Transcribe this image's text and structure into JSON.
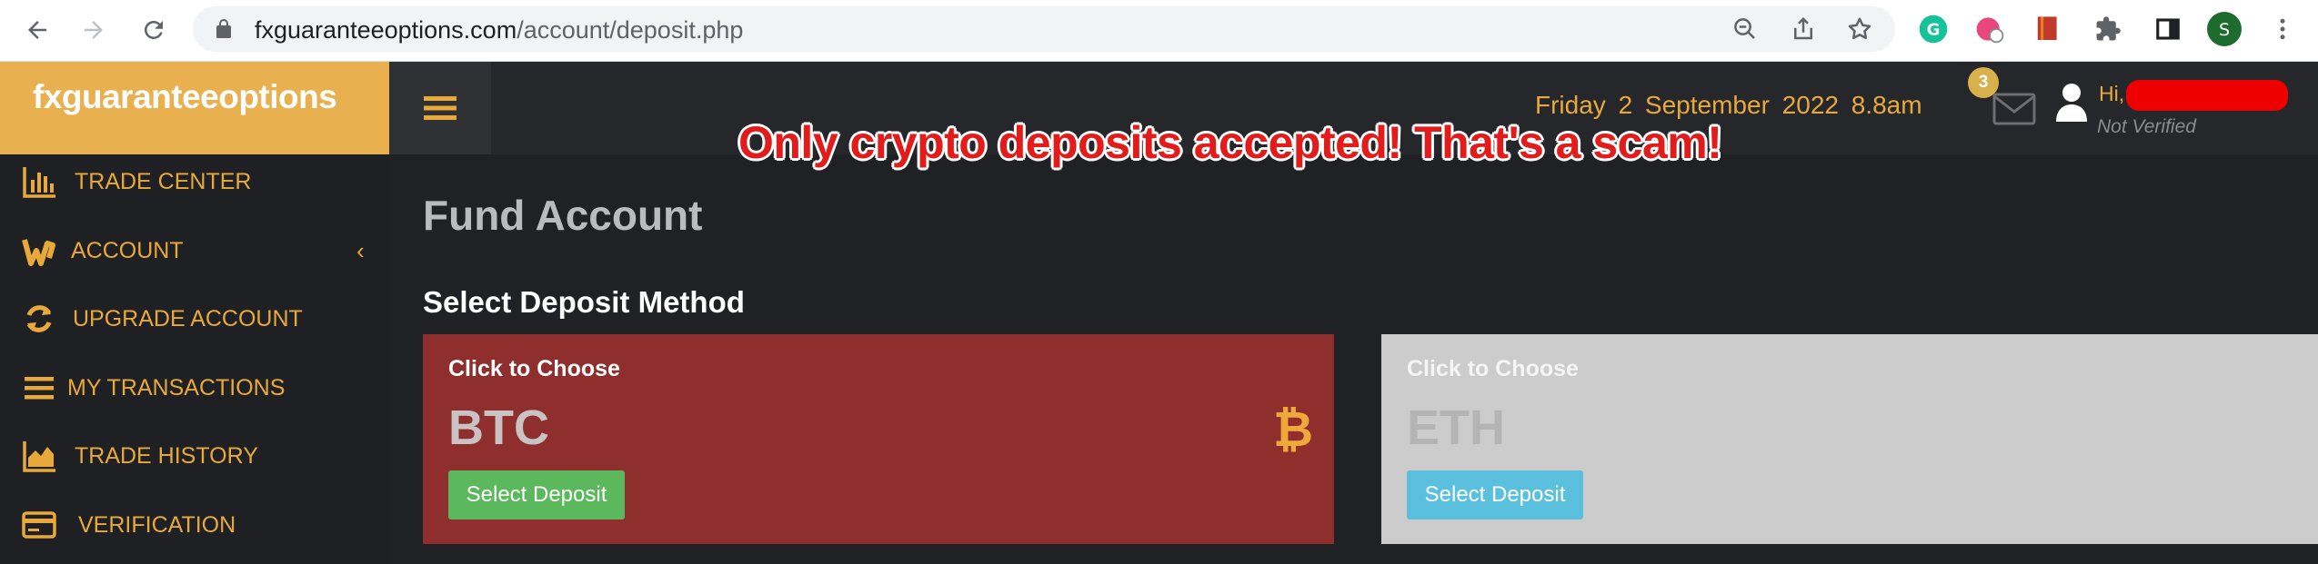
{
  "browser": {
    "url_host": "fxguaranteeoptions.com",
    "url_path": "/account/deposit.php",
    "profile_initial": "S"
  },
  "site": {
    "brand": "fxguaranteeoptions",
    "accent_color": "#e8b04f"
  },
  "sidebar": {
    "items": [
      {
        "label": "TRADE CENTER",
        "icon": "bar-chart-icon"
      },
      {
        "label": "ACCOUNT",
        "icon": "wallet-icon"
      },
      {
        "label": "UPGRADE ACCOUNT",
        "icon": "refresh-icon"
      },
      {
        "label": "MY TRANSACTIONS",
        "icon": "list-icon"
      },
      {
        "label": "TRADE HISTORY",
        "icon": "area-chart-icon"
      },
      {
        "label": "VERIFICATION",
        "icon": "id-card-icon"
      }
    ],
    "account_chevron": "‹"
  },
  "topbar": {
    "date": "Friday  2 September 2022  8.8am",
    "mail_badge": "3",
    "greeting": "Hi,",
    "verification_status": "Not Verified"
  },
  "annotation": "Only crypto deposits accepted! That's a scam!",
  "main": {
    "page_title": "Fund Account",
    "section_title": "Select Deposit Method",
    "cards": [
      {
        "choose_label": "Click to Choose",
        "coin": "BTC",
        "coin_symbol": "₿",
        "button_label": "Select Deposit",
        "color": "#8e2f2e"
      },
      {
        "choose_label": "Click to Choose",
        "coin": "ETH",
        "button_label": "Select Deposit",
        "color": "#cccccc"
      }
    ]
  }
}
